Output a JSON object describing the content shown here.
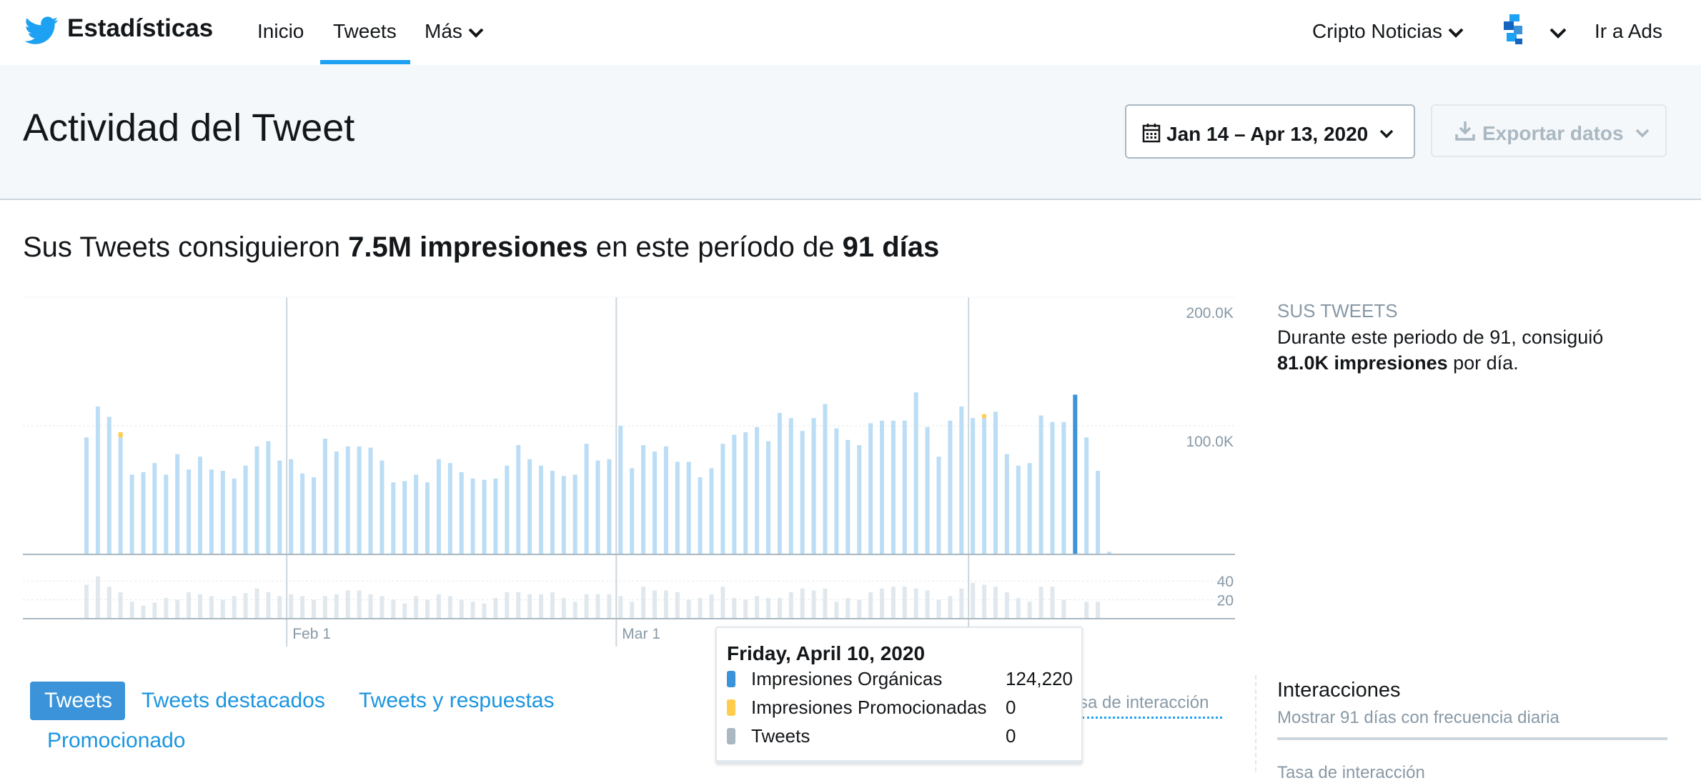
{
  "nav": {
    "brand": "Estadísticas",
    "items": [
      "Inicio",
      "Tweets",
      "Más"
    ],
    "account": "Cripto Noticias",
    "ads": "Ir a Ads"
  },
  "header": {
    "title": "Actividad del Tweet",
    "date_range": "Jan 14 – Apr 13, 2020",
    "export": "Exportar datos"
  },
  "summary": {
    "prefix": "Sus Tweets consiguieron ",
    "impressions": "7.5M impresiones",
    "middle": " en este período de ",
    "days": "91 días"
  },
  "side": {
    "title": "SUS TWEETS",
    "text": "Durante este periodo de 91, consiguió ",
    "per_day": "81.0K impresiones",
    "suffix": " por día."
  },
  "tabs": [
    "Tweets",
    "Tweets destacados",
    "Tweets y respuestas",
    "Promocionado"
  ],
  "rate_label": "sa de interacción",
  "interactions": {
    "title": "Interacciones",
    "subtitle": "Mostrar 91 días con frecuencia diaria",
    "cut_label": "Tasa de interacción"
  },
  "tooltip": {
    "date": "Friday, April 10, 2020",
    "rows": [
      {
        "label": "Impresiones Orgánicas",
        "value": "124,220",
        "color": "#3b94d9"
      },
      {
        "label": "Impresiones Promocionadas",
        "value": "0",
        "color": "#ffcc4d"
      },
      {
        "label": "Tweets",
        "value": "0",
        "color": "#aab8c2"
      }
    ]
  },
  "colors": {
    "accent": "#1da1f2",
    "bar": "#bbddf5",
    "bar_selected": "#3b94d9",
    "tweet_bar": "#e1e8ed",
    "promoted": "#ffcc4d"
  },
  "chart_data": {
    "type": "bar",
    "title": "",
    "x_start": "2020-01-14",
    "x_end": "2020-04-13",
    "x_ticks": [
      "Feb 1",
      "Mar 1"
    ],
    "impressions_axis": {
      "ticks": [
        "100.0K",
        "200.0K"
      ],
      "ylim": [
        0,
        200000
      ]
    },
    "tweets_axis": {
      "ticks": [
        "20",
        "40"
      ],
      "ylim": [
        0,
        50
      ]
    },
    "selected_date": "2020-04-10",
    "series": [
      {
        "name": "Impresiones Orgánicas",
        "values": [
          91000,
          115000,
          107000,
          91000,
          62000,
          64000,
          71000,
          62000,
          78000,
          66000,
          76000,
          66000,
          65000,
          59000,
          69000,
          84000,
          88000,
          73000,
          74000,
          63000,
          60000,
          90000,
          80000,
          84000,
          84000,
          83000,
          73000,
          56000,
          57000,
          62000,
          56000,
          74000,
          71000,
          64000,
          59000,
          58000,
          59000,
          69000,
          85000,
          74000,
          69000,
          65000,
          61000,
          62000,
          86000,
          73000,
          74000,
          100000,
          67000,
          85000,
          80000,
          84000,
          72000,
          72000,
          60000,
          67000,
          86000,
          93000,
          95000,
          99000,
          88000,
          110000,
          106000,
          96000,
          106000,
          117000,
          98000,
          89000,
          85000,
          102000,
          104000,
          104000,
          104000,
          126000,
          99000,
          76000,
          104000,
          115000,
          106000,
          106000,
          111000,
          78000,
          69000,
          71000,
          108000,
          103000,
          103000,
          124220,
          91000,
          65000,
          2000
        ],
        "color": "#bbddf5"
      },
      {
        "name": "Impresiones Promocionadas",
        "values": [
          0,
          0,
          0,
          4000,
          0,
          0,
          0,
          0,
          0,
          0,
          0,
          0,
          0,
          0,
          0,
          0,
          0,
          0,
          0,
          0,
          0,
          0,
          0,
          0,
          0,
          0,
          0,
          0,
          0,
          0,
          0,
          0,
          0,
          0,
          0,
          0,
          0,
          0,
          0,
          0,
          0,
          0,
          0,
          0,
          0,
          0,
          0,
          0,
          0,
          0,
          0,
          0,
          0,
          0,
          0,
          0,
          0,
          0,
          0,
          0,
          0,
          0,
          0,
          0,
          0,
          0,
          0,
          0,
          0,
          0,
          0,
          0,
          0,
          0,
          0,
          0,
          0,
          0,
          0,
          3000,
          0,
          0,
          0,
          0,
          0,
          0,
          0,
          0,
          0,
          0,
          0
        ],
        "color": "#ffcc4d"
      },
      {
        "name": "Tweets",
        "values": [
          36,
          45,
          34,
          28,
          18,
          14,
          17,
          22,
          20,
          28,
          26,
          24,
          20,
          24,
          27,
          32,
          28,
          24,
          26,
          24,
          20,
          24,
          26,
          30,
          30,
          26,
          24,
          20,
          16,
          24,
          20,
          26,
          24,
          20,
          18,
          16,
          22,
          28,
          28,
          26,
          26,
          28,
          22,
          18,
          26,
          26,
          26,
          24,
          18,
          34,
          30,
          30,
          28,
          20,
          22,
          26,
          34,
          22,
          20,
          24,
          22,
          22,
          28,
          32,
          30,
          32,
          18,
          22,
          20,
          28,
          32,
          34,
          34,
          32,
          30,
          20,
          24,
          32,
          38,
          36,
          34,
          28,
          22,
          18,
          34,
          34,
          20,
          0,
          18,
          18,
          0
        ]
      }
    ]
  }
}
